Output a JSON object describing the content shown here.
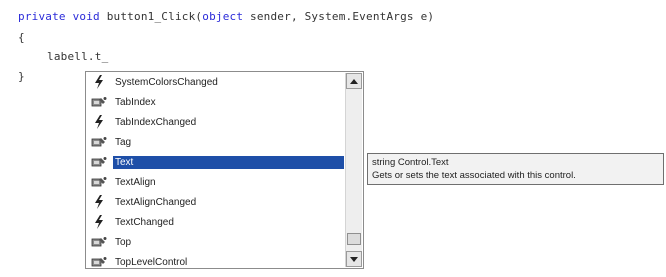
{
  "editor": {
    "line1": {
      "kw_private": "private",
      "kw_void": "void",
      "method": "button1_Click",
      "paren_open": "(",
      "kw_object": "object",
      "rest": "sender, System.EventArgs e)"
    },
    "line2": "{",
    "line3": "labell.t_",
    "line4": "}"
  },
  "completion": {
    "items": [
      {
        "label": "SystemColorsChanged",
        "icon": "event-icon"
      },
      {
        "label": "TabIndex",
        "icon": "property-icon"
      },
      {
        "label": "TabIndexChanged",
        "icon": "event-icon"
      },
      {
        "label": "Tag",
        "icon": "property-icon"
      },
      {
        "label": "Text",
        "icon": "property-icon",
        "selected": true
      },
      {
        "label": "TextAlign",
        "icon": "property-icon"
      },
      {
        "label": "TextAlignChanged",
        "icon": "event-icon"
      },
      {
        "label": "TextChanged",
        "icon": "event-icon"
      },
      {
        "label": "Top",
        "icon": "property-icon"
      },
      {
        "label": "TopLevelControl",
        "icon": "property-icon"
      }
    ]
  },
  "tooltip": {
    "signature": "string Control.Text",
    "description": "Gets or sets the text associated with this control."
  },
  "colors": {
    "keyword": "#2b2bd9",
    "selection": "#1e4fa8",
    "tooltip_bg": "#f2f2f2"
  }
}
